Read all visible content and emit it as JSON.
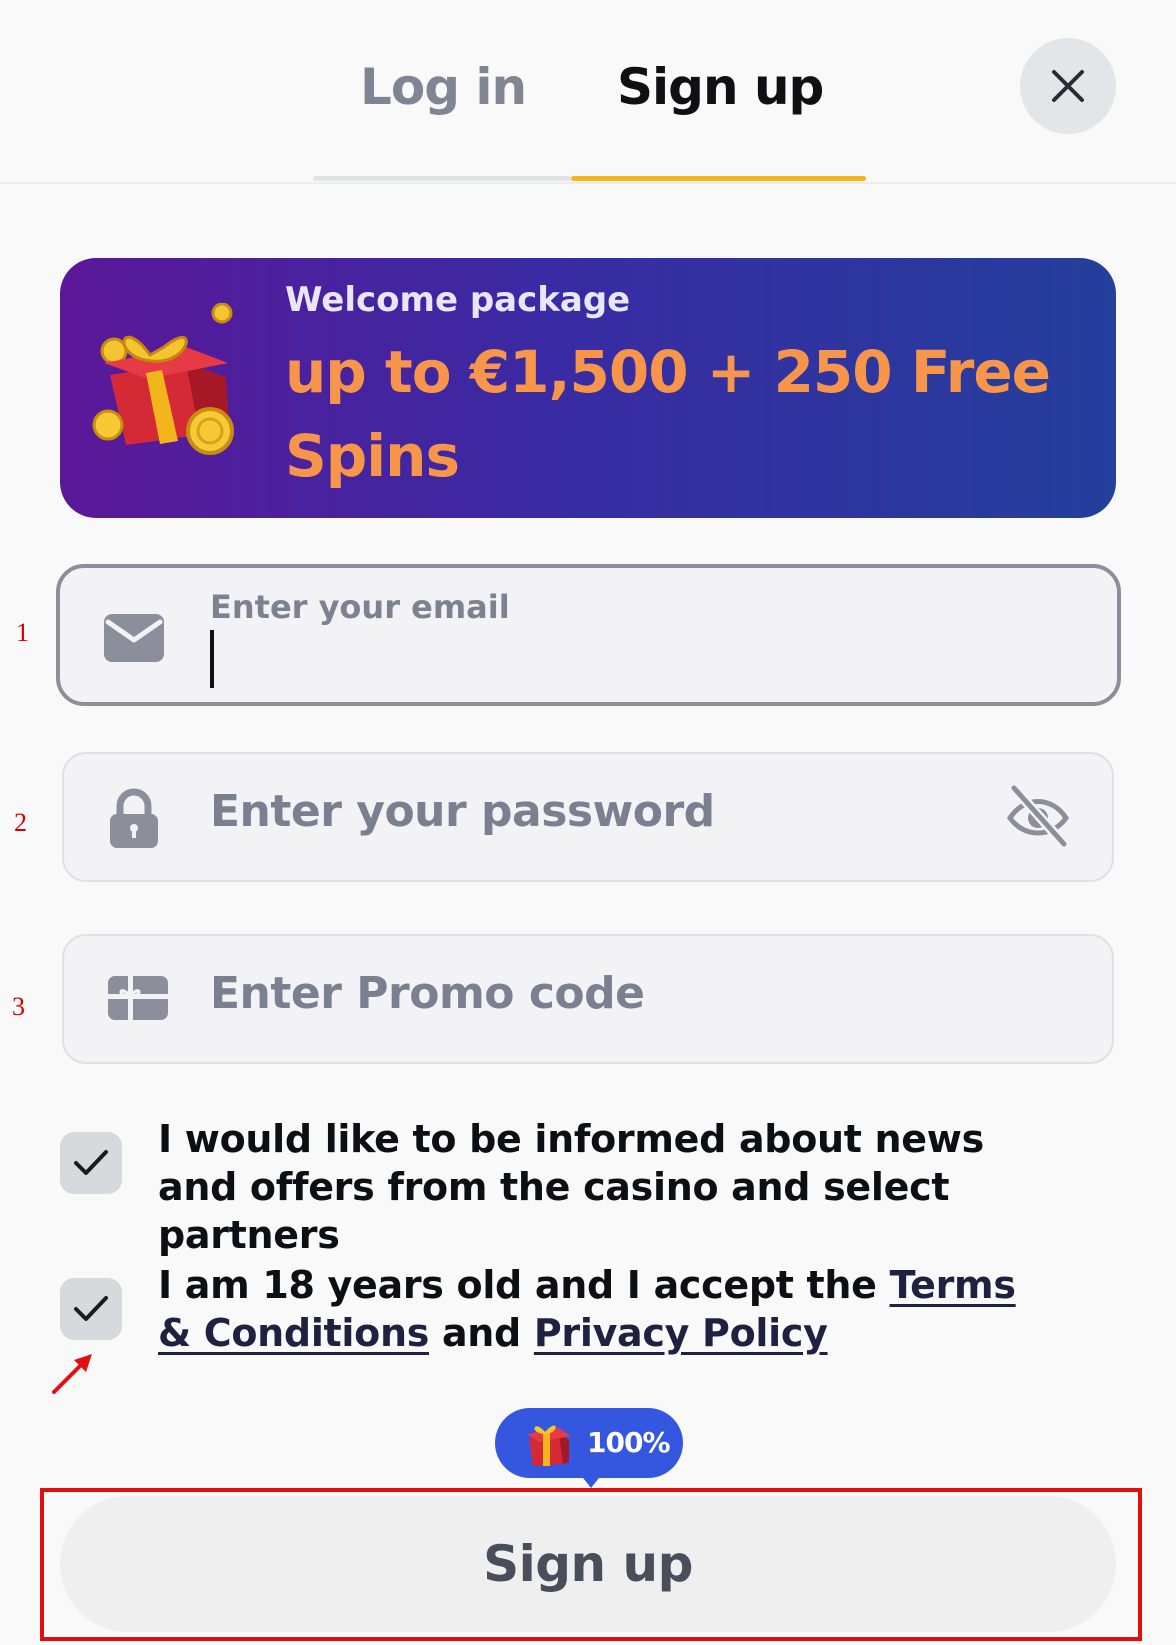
{
  "tabs": {
    "login_label": "Log in",
    "signup_label": "Sign up",
    "active_color": "#f6b41f"
  },
  "banner": {
    "subtitle": "Welcome package",
    "offer_line1": "up to €1,500 + 250 Free",
    "offer_line2": "Spins",
    "icon": "gift-box-icon"
  },
  "form": {
    "email": {
      "label": "Enter your email",
      "value": "",
      "icon": "envelope-icon"
    },
    "password": {
      "placeholder": "Enter your password",
      "icon": "lock-icon",
      "toggle_icon": "eye-slash-icon"
    },
    "promo": {
      "placeholder": "Enter Promo code",
      "icon": "gift-card-icon"
    }
  },
  "annotations": {
    "row1": "1",
    "row2": "2",
    "row3": "3"
  },
  "consents": {
    "news": {
      "checked": true,
      "text": "I would like to be informed about news and offers from the casino and select partners"
    },
    "age": {
      "checked": true,
      "prefix": "I am 18 years old and I accept the ",
      "terms_link": "Terms & Conditions",
      "middle": " and ",
      "privacy_link": "Privacy Policy"
    }
  },
  "bonus_badge": {
    "text": "100%",
    "icon": "gift-box-icon"
  },
  "submit": {
    "label": "Sign up"
  }
}
